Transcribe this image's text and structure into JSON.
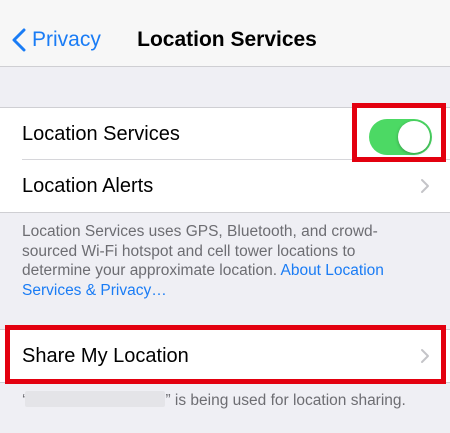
{
  "navbar": {
    "back_label": "Privacy",
    "title": "Location Services"
  },
  "location_group": {
    "location_services_label": "Location Services",
    "location_services_on": true,
    "location_alerts_label": "Location Alerts"
  },
  "description": {
    "text": "Location Services uses GPS, Bluetooth, and crowd-sourced Wi-Fi hotspot and cell tower locations to determine your approximate location. ",
    "link": "About Location Services & Privacy…"
  },
  "share_group": {
    "share_label": "Share My Location",
    "footer_open_quote": "‘",
    "footer_suffix": "” is being used for location sharing."
  },
  "colors": {
    "tint": "#1a7cf5",
    "toggle_on": "#4cd964",
    "highlight": "#e3000f"
  }
}
